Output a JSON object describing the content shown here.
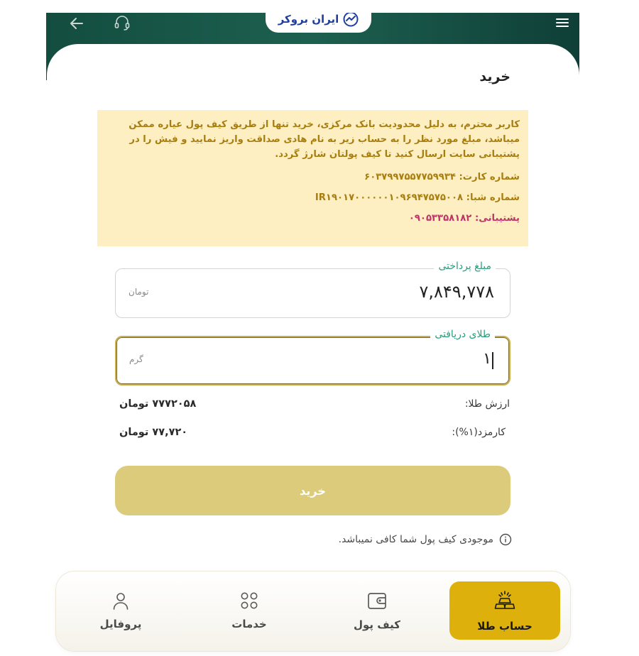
{
  "header": {
    "logo_text": "ایران بروکر",
    "back_icon": "arrow-left-icon",
    "support_icon": "headset-icon",
    "menu_icon": "hamburger-menu-icon"
  },
  "page": {
    "title": "خرید"
  },
  "notice": {
    "message": "کاربر محترم، به دلیل محدودیت بانک مرکزی، خرید تنها از طریق کیف پول عیاره ممکن میباشد، مبلغ مورد نظر را به حساب زیر به نام هادی صداقت واریز نمایید و فیش را در پشتیبانی سایت ارسال کنید تا کیف پولتان شارژ گردد.",
    "card_number": "شماره کارت: ۶۰۳۷۹۹۷۵۵۷۷۵۹۹۳۴",
    "sheba_number": "شماره شبا: IR۱۹۰۱۷۰۰۰۰۰۰۱۰۹۶۹۴۷۵۷۵۰۰۸",
    "support_phone": "پشتیبانی: ۰۹۰۵۳۳۵۸۱۸۲"
  },
  "form": {
    "payment_label": "مبلغ پرداختی",
    "payment_value": "۷,۸۴۹,۷۷۸",
    "payment_unit": "تومان",
    "gold_label": "طلای دریافتی",
    "gold_value": "۱",
    "gold_unit": "گرم"
  },
  "summary": {
    "gold_value_label": "ارزش طلا:",
    "gold_value_amount": "۷۷۷۲۰۵۸ تومان",
    "fee_label": "کارمزد(۱%):",
    "fee_amount": "۷۷,۷۲۰ تومان"
  },
  "buy_button_label": "خرید",
  "warning": {
    "icon": "info-circle-icon",
    "text": "موجودی کیف پول شما کافی نمیباشد."
  },
  "nav": {
    "items": [
      {
        "label": "حساب طلا",
        "icon": "gold-bars-icon",
        "active": true
      },
      {
        "label": "کیف پول",
        "icon": "wallet-icon",
        "active": false
      },
      {
        "label": "خدمات",
        "icon": "grid-icon",
        "active": false
      },
      {
        "label": "پروفایل",
        "icon": "user-icon",
        "active": false
      }
    ]
  },
  "colors": {
    "header_green": "#1d6050",
    "accent_teal": "#2a9d7c",
    "gold": "#ddb00c",
    "button_gold_disabled": "#ddcb7c",
    "notice_bg": "#fdefc2",
    "notice_text": "#a87e10",
    "support_pink": "#c0326a"
  }
}
